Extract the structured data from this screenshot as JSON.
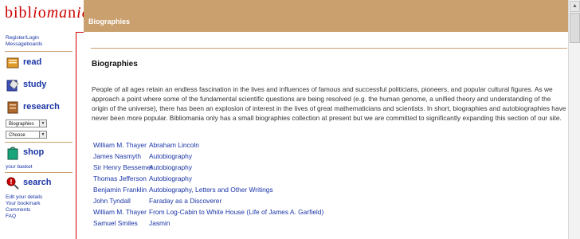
{
  "brand": {
    "logo_text": "bibliomania",
    "logo_parts": [
      "bibl",
      "i",
      "o",
      "ma",
      "n",
      "ia"
    ]
  },
  "header": {
    "title": "Biographies"
  },
  "sidebar": {
    "top_links": [
      "Register/Login",
      "Messageboards"
    ],
    "nav": [
      {
        "label": "read",
        "icon": "read-icon"
      },
      {
        "label": "study",
        "icon": "study-icon"
      },
      {
        "label": "research",
        "icon": "research-icon"
      },
      {
        "label": "shop",
        "icon": "shop-icon"
      },
      {
        "label": "search",
        "icon": "search-icon"
      }
    ],
    "research_select": {
      "value": "Biographies"
    },
    "research_choose": {
      "value": "Choose"
    },
    "shop_link": "your basket",
    "bottom_links": [
      "Edit your details",
      "Your bookmark",
      "Comments",
      "FAQ"
    ]
  },
  "main": {
    "title": "Biographies",
    "intro": "People of all ages retain an endless fascination in the lives and influences of famous and successful politicians, pioneers, and popular cultural figures. As we approach a point where some of the fundamental scientific questions are being resolved (e.g. the human genome, a unified theory and understanding of the origin of the universe), there has been an explosion of interest in the lives of great mathematicians and scientists. In short, biographies and autobiographies have never been more popular. Bibliomania only has a small biographies collection at present but we are committed to significantly expanding this section of our site.",
    "biographies": [
      {
        "author": "William M. Thayer",
        "title": "Abraham Lincoln"
      },
      {
        "author": "James Nasmyth",
        "title": "Autobiography"
      },
      {
        "author": "Sir Henry Bessemer",
        "title": "Autobiography"
      },
      {
        "author": "Thomas Jefferson",
        "title": "Autobiography"
      },
      {
        "author": "Benjamin Franklin",
        "title": "Autobiography, Letters and Other Writings"
      },
      {
        "author": "John Tyndall",
        "title": "Faraday as a Discoverer"
      },
      {
        "author": "William M. Thayer",
        "title": "From Log-Cabin to White House (Life of James A. Garfield)"
      },
      {
        "author": "Samuel Smiles",
        "title": "Jasmin"
      }
    ]
  },
  "colors": {
    "brand_red": "#cc0000",
    "header_tan": "#c9a06e",
    "link_blue": "#1a35a6"
  }
}
